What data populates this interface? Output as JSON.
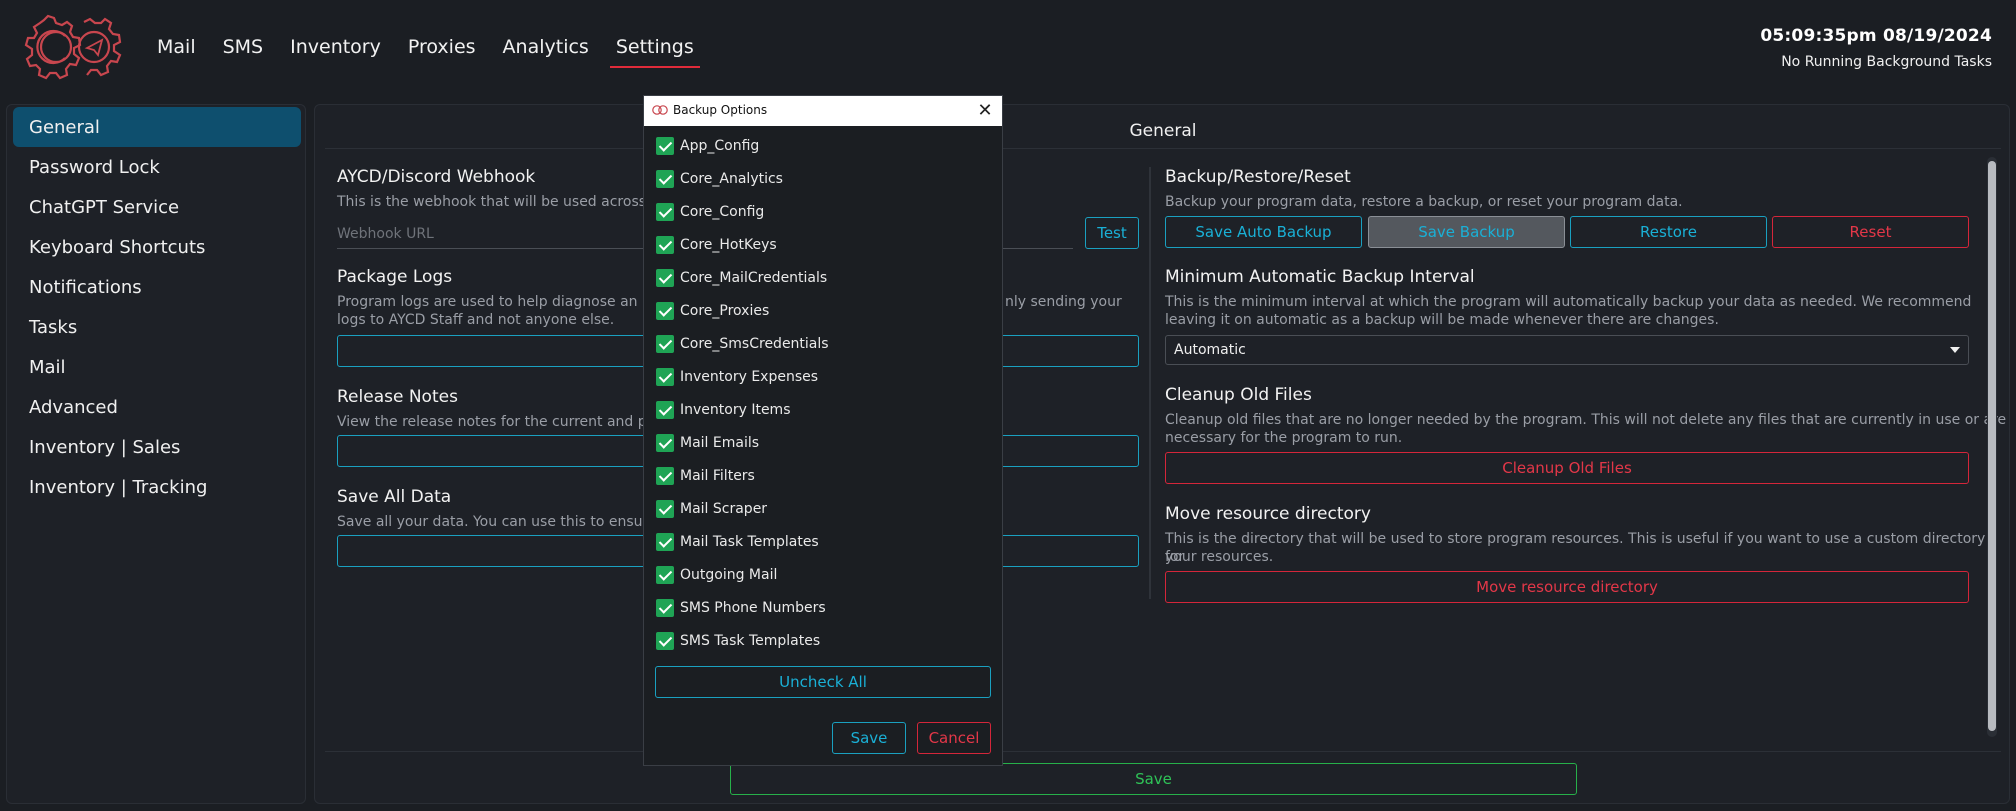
{
  "header": {
    "nav": [
      {
        "label": "Mail",
        "active": false
      },
      {
        "label": "SMS",
        "active": false
      },
      {
        "label": "Inventory",
        "active": false
      },
      {
        "label": "Proxies",
        "active": false
      },
      {
        "label": "Analytics",
        "active": false
      },
      {
        "label": "Settings",
        "active": true
      }
    ],
    "time": "05:09:35pm 08/19/2024",
    "background_tasks": "No Running Background Tasks",
    "accent_color": "#e02b3a"
  },
  "sidebar": {
    "items": [
      {
        "label": "General",
        "active": true
      },
      {
        "label": "Password Lock"
      },
      {
        "label": "ChatGPT Service"
      },
      {
        "label": "Keyboard Shortcuts"
      },
      {
        "label": "Notifications"
      },
      {
        "label": "Tasks"
      },
      {
        "label": "Mail"
      },
      {
        "label": "Advanced"
      },
      {
        "label": "Inventory | Sales"
      },
      {
        "label": "Inventory | Tracking"
      }
    ]
  },
  "main": {
    "title": "General",
    "webhook": {
      "title": "AYCD/Discord Webhook",
      "desc": "This is the webhook that will be used across th",
      "placeholder": "Webhook URL",
      "test_label": "Test"
    },
    "logs": {
      "title": "Package Logs",
      "desc_line1": "Program logs are used to help diagnose an iss",
      "desc_line1_end": "nly sending your",
      "desc_line2": "logs to AYCD Staff and not anyone else."
    },
    "release": {
      "title": "Release Notes",
      "desc": "View the release notes for the current and pre"
    },
    "save_all": {
      "title": "Save All Data",
      "desc": "Save all your data. You can use this to ensure"
    },
    "backup": {
      "title": "Backup/Restore/Reset",
      "desc": "Backup your program data, restore a backup, or reset your program data.",
      "buttons": {
        "save_auto": "Save Auto Backup",
        "save_backup": "Save Backup",
        "restore": "Restore",
        "reset": "Reset"
      }
    },
    "interval": {
      "title": "Minimum Automatic Backup Interval",
      "desc_line1": "This is the minimum interval at which the program will automatically backup your data as needed. We recommend",
      "desc_line2": "leaving it on automatic as a backup will be made whenever there are changes.",
      "value": "Automatic"
    },
    "cleanup": {
      "title": "Cleanup Old Files",
      "desc_line1": "Cleanup old files that are no longer needed by the program. This will not delete any files that are currently in use or are",
      "desc_line2": "necessary for the program to run.",
      "button": "Cleanup Old Files"
    },
    "move_dir": {
      "title": "Move resource directory",
      "desc_line1": "This is the directory that will be used to store program resources. This is useful if you want to use a custom directory for",
      "desc_line2": "your resources.",
      "button": "Move resource directory"
    },
    "save_label": "Save"
  },
  "modal": {
    "title": "Backup Options",
    "options": [
      {
        "label": "App_Config",
        "checked": true
      },
      {
        "label": "Core_Analytics",
        "checked": true
      },
      {
        "label": "Core_Config",
        "checked": true
      },
      {
        "label": "Core_HotKeys",
        "checked": true
      },
      {
        "label": "Core_MailCredentials",
        "checked": true
      },
      {
        "label": "Core_Proxies",
        "checked": true
      },
      {
        "label": "Core_SmsCredentials",
        "checked": true
      },
      {
        "label": "Inventory Expenses",
        "checked": true
      },
      {
        "label": "Inventory Items",
        "checked": true
      },
      {
        "label": "Mail Emails",
        "checked": true
      },
      {
        "label": "Mail Filters",
        "checked": true
      },
      {
        "label": "Mail Scraper",
        "checked": true
      },
      {
        "label": "Mail Task Templates",
        "checked": true
      },
      {
        "label": "Outgoing Mail",
        "checked": true
      },
      {
        "label": "SMS Phone Numbers",
        "checked": true
      },
      {
        "label": "SMS Task Templates",
        "checked": true
      }
    ],
    "uncheck_all": "Uncheck All",
    "save": "Save",
    "cancel": "Cancel"
  }
}
